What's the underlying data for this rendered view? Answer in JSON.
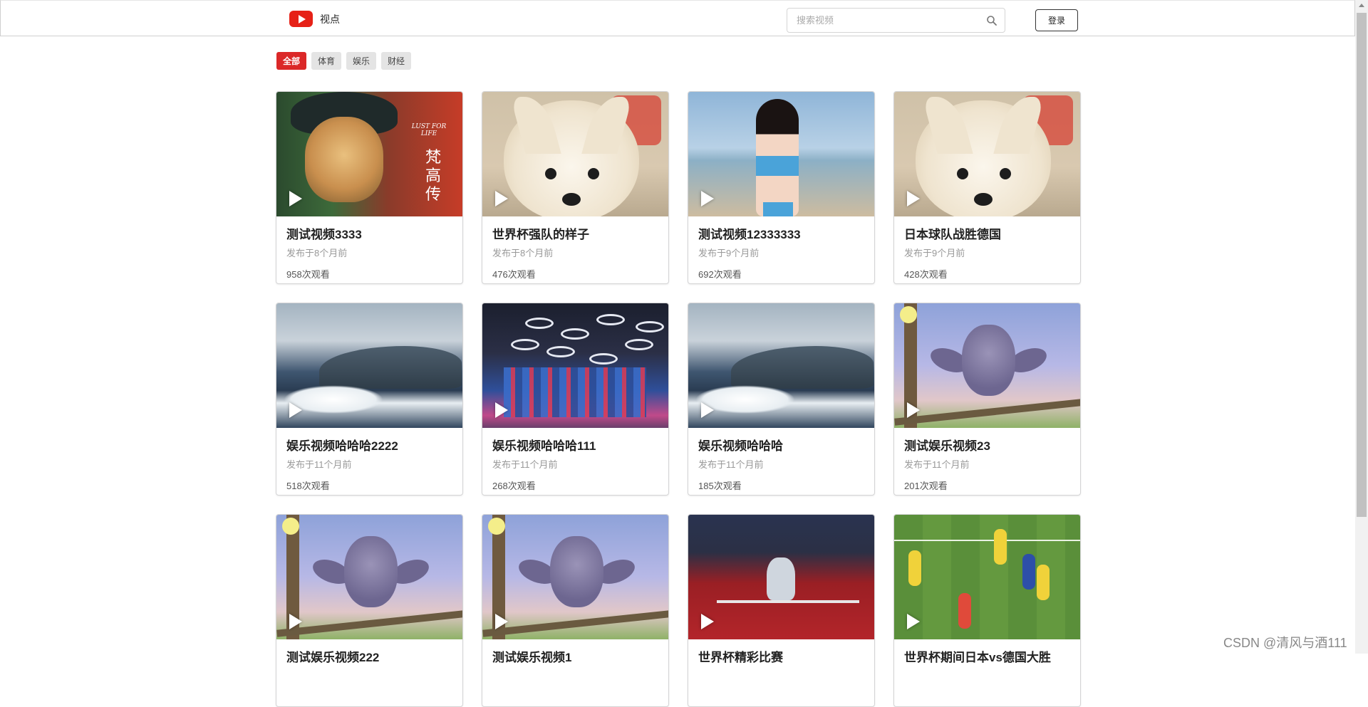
{
  "header": {
    "brand": "视点",
    "search_placeholder": "搜索视频",
    "login_label": "登录",
    "logo_icon": "play-logo-icon",
    "search_icon": "search-icon"
  },
  "tabs": [
    {
      "label": "全部",
      "active": true
    },
    {
      "label": "体育",
      "active": false
    },
    {
      "label": "娱乐",
      "active": false
    },
    {
      "label": "财经",
      "active": false
    }
  ],
  "videos": [
    {
      "title": "测试视频3333",
      "published": "发布于8个月前",
      "views": "958次观看",
      "thumb": "gogh"
    },
    {
      "title": "世界杯强队的样子",
      "published": "发布于8个月前",
      "views": "476次观看",
      "thumb": "dog"
    },
    {
      "title": "测试视频12333333",
      "published": "发布于9个月前",
      "views": "692次观看",
      "thumb": "beach"
    },
    {
      "title": "日本球队战胜德国",
      "published": "发布于9个月前",
      "views": "428次观看",
      "thumb": "dog"
    },
    {
      "title": "娱乐视频哈哈哈2222",
      "published": "发布于11个月前",
      "views": "518次观看",
      "thumb": "whale"
    },
    {
      "title": "娱乐视频哈哈哈111",
      "published": "发布于11个月前",
      "views": "268次观看",
      "thumb": "mall"
    },
    {
      "title": "娱乐视频哈哈哈",
      "published": "发布于11个月前",
      "views": "185次观看",
      "thumb": "whale"
    },
    {
      "title": "测试娱乐视频23",
      "published": "发布于11个月前",
      "views": "201次观看",
      "thumb": "bird"
    },
    {
      "title": "测试娱乐视频222",
      "published": "",
      "views": "",
      "thumb": "bird"
    },
    {
      "title": "测试娱乐视频1",
      "published": "",
      "views": "",
      "thumb": "bird"
    },
    {
      "title": "世界杯精彩比赛",
      "published": "",
      "views": "",
      "thumb": "team"
    },
    {
      "title": "世界杯期间日本vs德国大胜",
      "published": "",
      "views": "",
      "thumb": "soccer"
    }
  ],
  "gogh_cover": {
    "cn": "梵高传",
    "en": "LUST FOR LIFE"
  },
  "watermark": "CSDN @清风与酒111",
  "colors": {
    "accent": "#db2828",
    "logo": "#e62117"
  }
}
